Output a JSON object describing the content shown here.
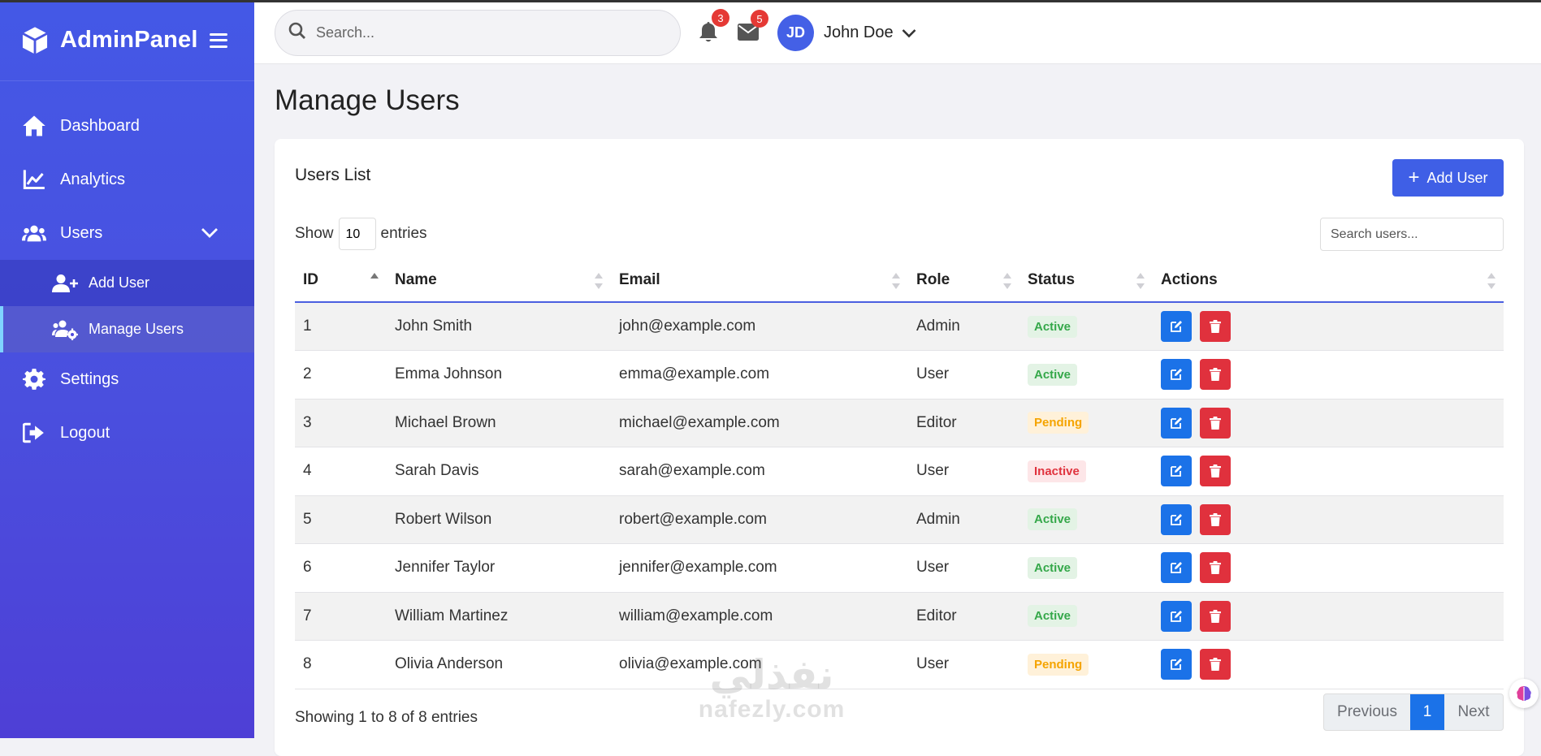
{
  "brand": {
    "name": "AdminPanel",
    "accent": "#4458e6"
  },
  "sidebar": {
    "items": [
      {
        "label": "Dashboard",
        "icon": "home-icon"
      },
      {
        "label": "Analytics",
        "icon": "chart-line-icon"
      },
      {
        "label": "Users",
        "icon": "users-icon",
        "expanded": true
      },
      {
        "label": "Settings",
        "icon": "gear-icon"
      },
      {
        "label": "Logout",
        "icon": "logout-icon"
      }
    ],
    "users_sub": [
      {
        "label": "Add User",
        "icon": "user-plus-icon"
      },
      {
        "label": "Manage Users",
        "icon": "users-cog-icon",
        "active": true
      }
    ]
  },
  "header": {
    "search_placeholder": "Search...",
    "notifications_count": "3",
    "messages_count": "5",
    "user_initials": "JD",
    "user_name": "John Doe"
  },
  "page": {
    "title": "Manage Users"
  },
  "card": {
    "title": "Users List",
    "add_button": "Add User",
    "show_label": "Show",
    "entries_label": "entries",
    "page_length": "10",
    "filter_placeholder": "Search users..."
  },
  "table": {
    "columns": [
      "ID",
      "Name",
      "Email",
      "Role",
      "Status",
      "Actions"
    ],
    "rows": [
      {
        "id": "1",
        "name": "John Smith",
        "email": "john@example.com",
        "role": "Admin",
        "status": "Active"
      },
      {
        "id": "2",
        "name": "Emma Johnson",
        "email": "emma@example.com",
        "role": "User",
        "status": "Active"
      },
      {
        "id": "3",
        "name": "Michael Brown",
        "email": "michael@example.com",
        "role": "Editor",
        "status": "Pending"
      },
      {
        "id": "4",
        "name": "Sarah Davis",
        "email": "sarah@example.com",
        "role": "User",
        "status": "Inactive"
      },
      {
        "id": "5",
        "name": "Robert Wilson",
        "email": "robert@example.com",
        "role": "Admin",
        "status": "Active"
      },
      {
        "id": "6",
        "name": "Jennifer Taylor",
        "email": "jennifer@example.com",
        "role": "User",
        "status": "Active"
      },
      {
        "id": "7",
        "name": "William Martinez",
        "email": "william@example.com",
        "role": "Editor",
        "status": "Active"
      },
      {
        "id": "8",
        "name": "Olivia Anderson",
        "email": "olivia@example.com",
        "role": "User",
        "status": "Pending"
      }
    ]
  },
  "footer": {
    "info": "Showing 1 to 8 of 8 entries",
    "prev": "Previous",
    "current_page": "1",
    "next": "Next"
  },
  "watermark": {
    "arabic": "نفذلي",
    "latin": "nafezly.com"
  },
  "colors": {
    "active": "#35a84a",
    "pending": "#f5a400",
    "inactive": "#e0333e",
    "edit": "#1b72e8",
    "delete": "#e0313d",
    "primary": "#3f5fe6"
  }
}
